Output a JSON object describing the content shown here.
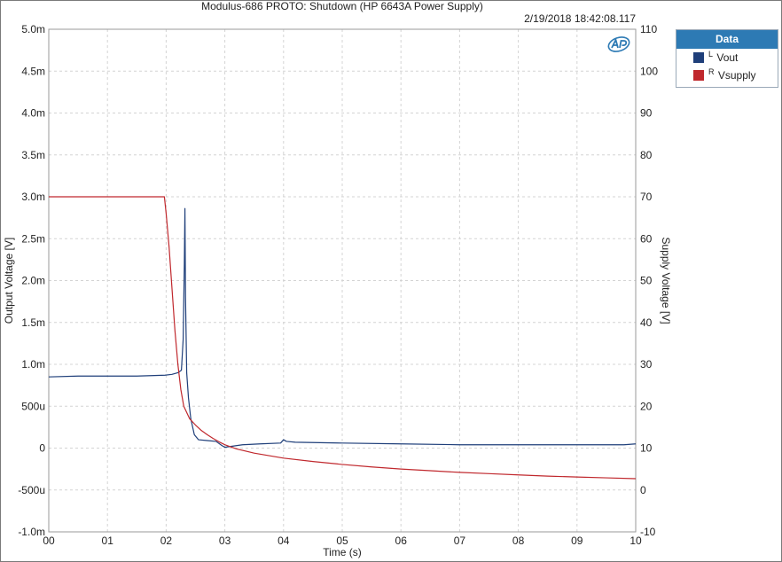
{
  "chart_data": {
    "type": "line",
    "title": "Modulus-686 PROTO: Shutdown (HP 6643A Power Supply)",
    "timestamp": "2/19/2018 18:42:08.117",
    "xlabel": "Time (s)",
    "ylabel_left": "Output Voltage [V]",
    "ylabel_right": "Supply Voltage [V]",
    "xlim": [
      0,
      10
    ],
    "ylim_left": [
      -0.001,
      0.005
    ],
    "ylim_right": [
      -10,
      110
    ],
    "grid": true,
    "legend_placement": "outside-top-right",
    "x_ticks": [
      "00",
      "01",
      "02",
      "03",
      "04",
      "05",
      "06",
      "07",
      "08",
      "09",
      "10"
    ],
    "y_left_ticks": [
      "5.0m",
      "4.5m",
      "4.0m",
      "3.5m",
      "3.0m",
      "2.5m",
      "2.0m",
      "1.5m",
      "1.0m",
      "500u",
      "0",
      "-500u",
      "-1.0m"
    ],
    "y_right_ticks": [
      "110",
      "100",
      "90",
      "80",
      "70",
      "60",
      "50",
      "40",
      "30",
      "20",
      "10",
      "0",
      "-10"
    ],
    "legend": {
      "title": "Data",
      "items": [
        {
          "channel": "L",
          "label": "Vout",
          "color": "#1f3f7a"
        },
        {
          "channel": "R",
          "label": "Vsupply",
          "color": "#c0282d"
        }
      ]
    },
    "series": [
      {
        "name": "Vout",
        "axis": "left",
        "color": "#1f3f7a",
        "x": [
          0,
          0.5,
          1.0,
          1.5,
          1.98,
          2.1,
          2.2,
          2.26,
          2.29,
          2.31,
          2.32,
          2.33,
          2.35,
          2.38,
          2.42,
          2.48,
          2.55,
          2.7,
          2.85,
          2.95,
          3.0,
          3.1,
          3.3,
          3.6,
          3.95,
          4.0,
          4.05,
          4.2,
          5.0,
          6.0,
          7.0,
          8.0,
          9.0,
          9.8,
          10.0
        ],
        "y": [
          0.00085,
          0.00086,
          0.00086,
          0.00086,
          0.00087,
          0.00088,
          0.0009,
          0.00093,
          0.0013,
          0.0022,
          0.00286,
          0.0018,
          0.0009,
          0.0006,
          0.00035,
          0.00016,
          0.0001,
          9e-05,
          8e-05,
          3e-05,
          1e-05,
          2e-05,
          4e-05,
          5e-05,
          6e-05,
          0.0001,
          8e-05,
          7e-05,
          6e-05,
          5e-05,
          4e-05,
          4e-05,
          4e-05,
          4e-05,
          5e-05
        ]
      },
      {
        "name": "Vsupply",
        "axis": "right",
        "color": "#c0282d",
        "x": [
          0,
          1.0,
          1.97,
          2.0,
          2.05,
          2.1,
          2.15,
          2.2,
          2.25,
          2.3,
          2.4,
          2.5,
          2.6,
          2.7,
          2.8,
          2.9,
          3.0,
          3.2,
          3.5,
          4.0,
          4.5,
          5.0,
          5.5,
          6.0,
          6.5,
          7.0,
          7.5,
          8.0,
          8.5,
          9.0,
          9.5,
          10.0
        ],
        "y": [
          70,
          70,
          70,
          66,
          58,
          48,
          38,
          30,
          24,
          20,
          17,
          15.5,
          14.2,
          13.2,
          12.3,
          11.5,
          10.8,
          9.8,
          8.8,
          7.6,
          6.8,
          6.1,
          5.5,
          5.0,
          4.6,
          4.2,
          3.9,
          3.6,
          3.3,
          3.1,
          2.9,
          2.7
        ]
      }
    ]
  }
}
